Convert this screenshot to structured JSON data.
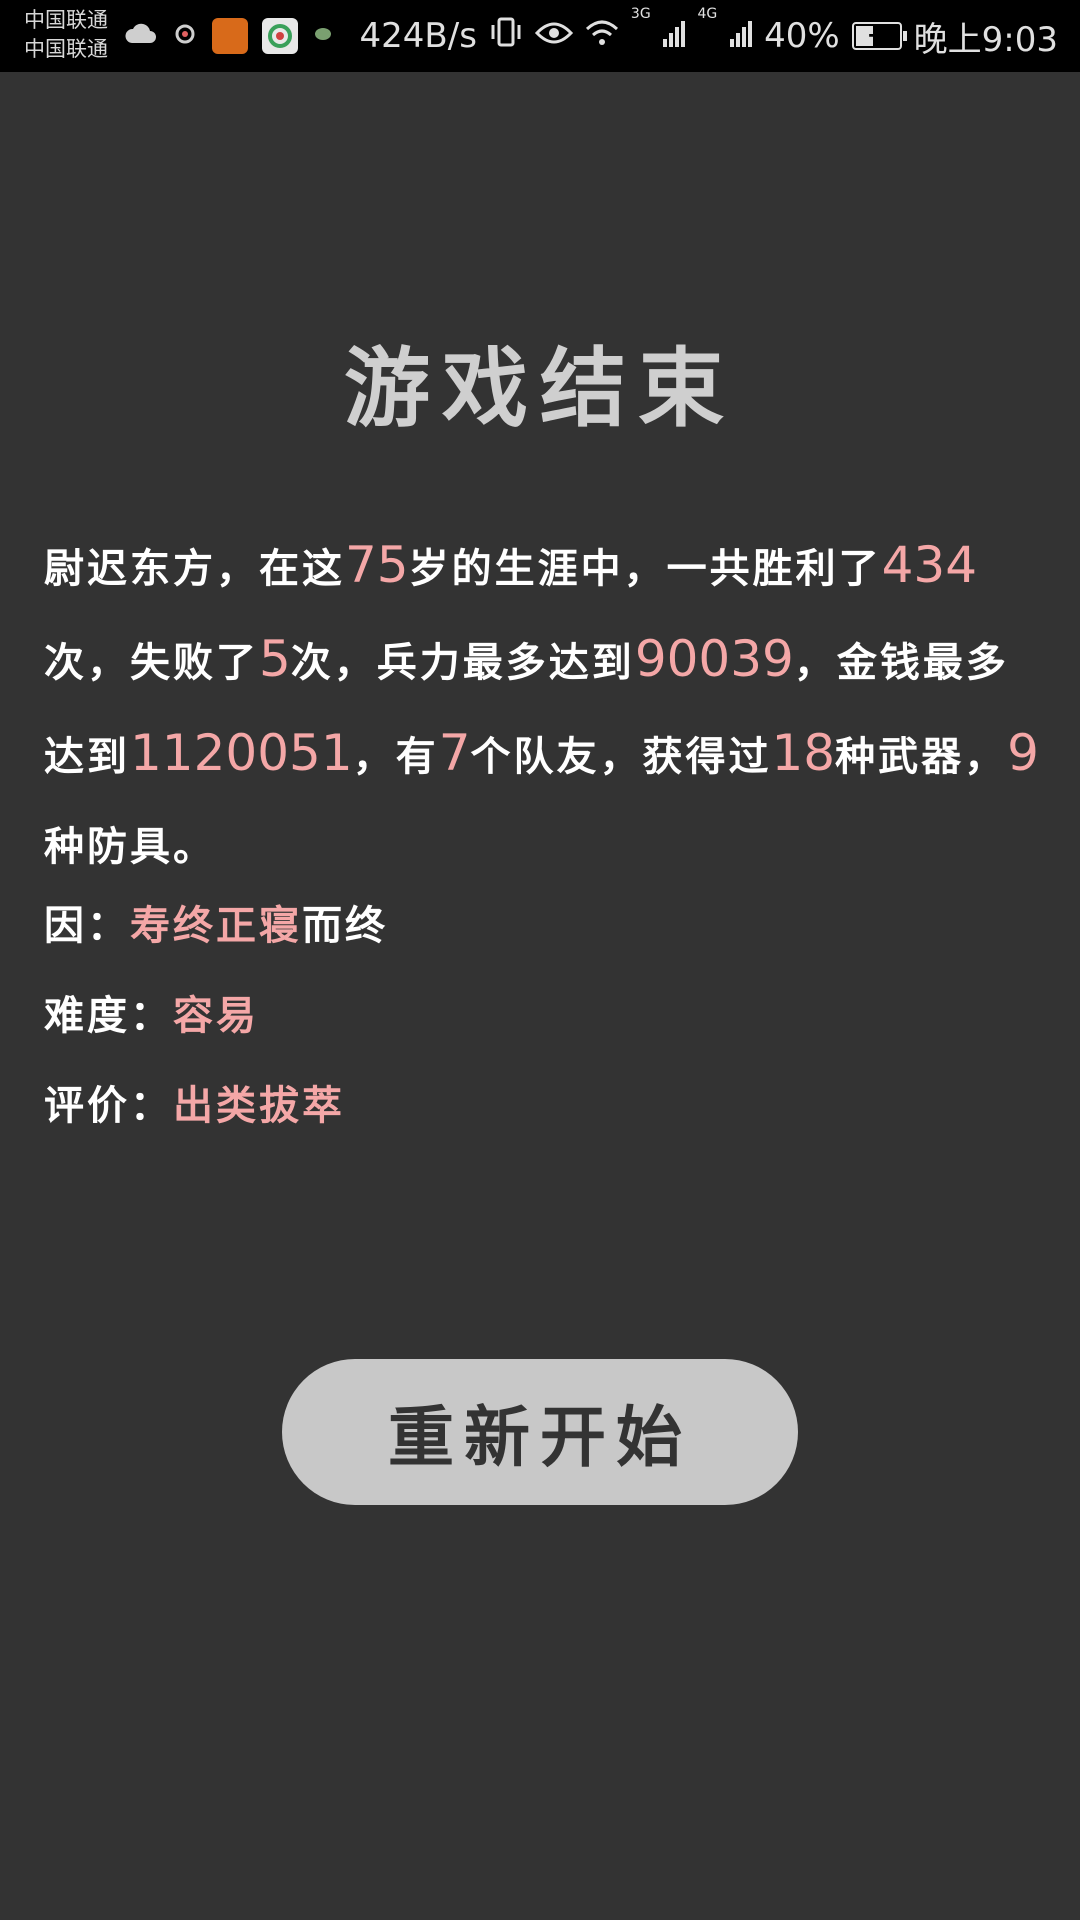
{
  "status_bar": {
    "carrier_1": "中国联通",
    "carrier_2": "中国联通",
    "net_speed": "424B/s",
    "signal_1": "3G",
    "signal_2": "4G",
    "battery_percent": "40%",
    "battery_level": 0.4,
    "time": "晚上9:03",
    "icons": [
      "cloud-icon",
      "scan-icon",
      "game-app-icon",
      "browser-app-icon",
      "leaf-icon",
      "vibrate-icon",
      "eye-icon",
      "wifi-icon",
      "signal-icon",
      "battery-icon"
    ]
  },
  "title": "游戏结束",
  "summary": {
    "name": "尉迟东方",
    "t1": "，在这",
    "age": "75",
    "t2": "岁的生涯中，一共胜利了",
    "wins": "434",
    "t3": "次，失败了",
    "losses": "5",
    "t4": "次，兵力最多达到",
    "max_troops": "90039",
    "t5": "，金钱最多达到",
    "max_money": "1120051",
    "t6": "，有",
    "teammates": "7",
    "t7": "个队友，获得过",
    "weapons": "18",
    "t8": "种武器，",
    "armors": "9",
    "t9": "种防具。"
  },
  "cause": {
    "label": "因：",
    "value": "寿终正寝",
    "suffix": "而终"
  },
  "difficulty": {
    "label": "难度：",
    "value": "容易"
  },
  "rating": {
    "label": "评价：",
    "value": "出类拔萃"
  },
  "restart_button": "重新开始",
  "colors": {
    "background": "#333333",
    "highlight": "#f4a7a7",
    "button": "#c8c8c8",
    "title": "#cfcfcf"
  }
}
